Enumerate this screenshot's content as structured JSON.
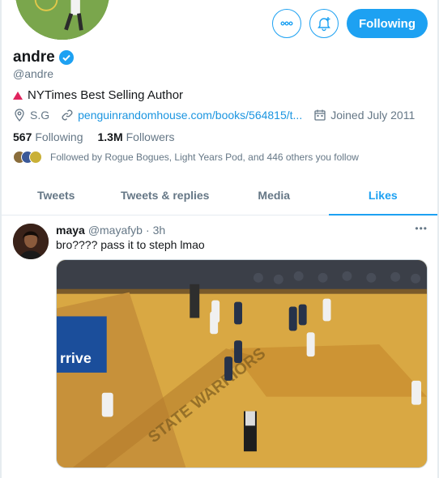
{
  "profile": {
    "name": "andre",
    "handle": "@andre",
    "bio": "NYTimes Best Selling Author",
    "location": "S.G",
    "website": "penguinrandomhouse.com/books/564815/t...",
    "joined": "Joined July 2011",
    "following_count": "567",
    "following_label": "Following",
    "followers_count": "1.3M",
    "followers_label": "Followers",
    "followed_by": "Followed by Rogue Bogues, Light Years Pod, and 446 others you follow"
  },
  "actions": {
    "more_icon": "more-icon",
    "notify_icon": "bell-plus-icon",
    "follow_label": "Following"
  },
  "tabs": [
    {
      "label": "Tweets",
      "active": false
    },
    {
      "label": "Tweets & replies",
      "active": false
    },
    {
      "label": "Media",
      "active": false
    },
    {
      "label": "Likes",
      "active": true
    }
  ],
  "tweet": {
    "name": "maya",
    "handle": "@mayafyb",
    "dot": "·",
    "time": "3h",
    "text": "bro???? pass it to steph lmao",
    "more": "•••",
    "media_caption_text": "STATE WARRIORS",
    "media_banner_text": "rrive"
  },
  "colors": {
    "accent": "#1da1f2",
    "verified": "#1da1f2",
    "triangle": "#e0245e",
    "muted": "#657786"
  }
}
